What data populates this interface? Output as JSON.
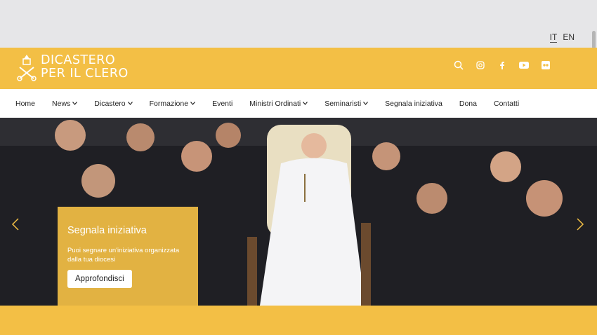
{
  "lang": {
    "it": "IT",
    "en": "EN"
  },
  "header": {
    "logo_line1": "DICASTERO",
    "logo_line2": "PER IL CLERO"
  },
  "icons": [
    "search-icon",
    "instagram-icon",
    "facebook-icon",
    "youtube-icon",
    "flickr-icon"
  ],
  "nav": [
    {
      "label": "Home",
      "dropdown": false
    },
    {
      "label": "News",
      "dropdown": true
    },
    {
      "label": "Dicastero",
      "dropdown": true
    },
    {
      "label": "Formazione",
      "dropdown": true
    },
    {
      "label": "Eventi",
      "dropdown": false
    },
    {
      "label": "Ministri Ordinati",
      "dropdown": true
    },
    {
      "label": "Seminaristi",
      "dropdown": true
    },
    {
      "label": "Segnala iniziativa",
      "dropdown": false
    },
    {
      "label": "Dona",
      "dropdown": false
    },
    {
      "label": "Contatti",
      "dropdown": false
    }
  ],
  "hero_card": {
    "title": "Segnala iniziativa",
    "text": "Puoi segnare un'iniziativa organizzata dalla tua diocesi",
    "button": "Approfondisci"
  },
  "colors": {
    "brand": "#f3bf45"
  }
}
